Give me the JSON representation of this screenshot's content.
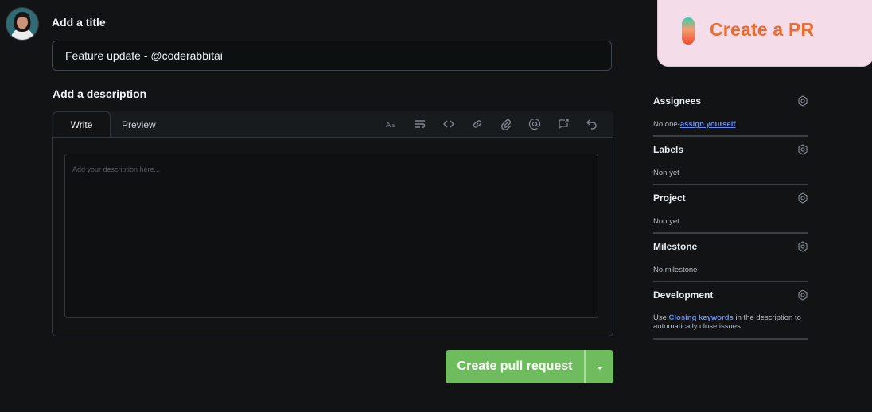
{
  "form": {
    "title_label": "Add a title",
    "title_value": "Feature update - @coderabbitai",
    "description_label": "Add a description",
    "tabs": [
      "Write",
      "Preview"
    ],
    "description_placeholder": "Add your description here...",
    "toolbar_icons": [
      "text-size-icon",
      "list-icon",
      "code-icon",
      "link-icon",
      "attachment-icon",
      "mention-icon",
      "reference-icon",
      "undo-icon"
    ],
    "submit_label": "Create pull request"
  },
  "promo": {
    "label": "Create a PR"
  },
  "sidebar": {
    "assignees": {
      "title": "Assignees",
      "prefix": "No one-",
      "link": "assign yourself"
    },
    "labels": {
      "title": "Labels",
      "value": "Non yet"
    },
    "project": {
      "title": "Project",
      "value": "Non yet"
    },
    "milestone": {
      "title": "Milestone",
      "value": "No milestone"
    },
    "development": {
      "title": "Development",
      "prefix": "Use ",
      "link": "Closing keywords",
      "suffix": " in the description to automatically close issues"
    }
  },
  "colors": {
    "primary_button": "#6fbc5f",
    "accent_link": "#6a8cf2",
    "promo_text": "#f06a2b",
    "promo_bg": "#f4dce8"
  }
}
